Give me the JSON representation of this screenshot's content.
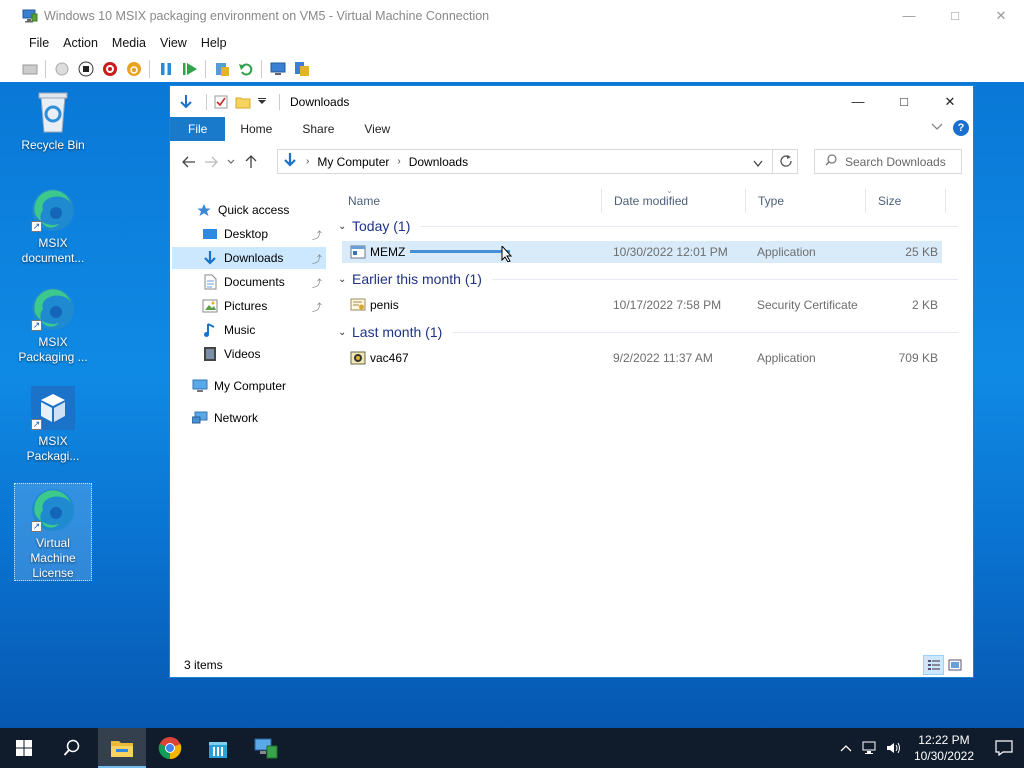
{
  "vm_window": {
    "title": "Windows 10 MSIX packaging environment on VM5 - Virtual Machine Connection",
    "menu": [
      "File",
      "Action",
      "Media",
      "View",
      "Help"
    ]
  },
  "desktop": {
    "icons": [
      {
        "label": "Recycle Bin",
        "icon": "recycle-bin-icon"
      },
      {
        "label": "MSIX document...",
        "icon": "edge-icon"
      },
      {
        "label": "MSIX Packaging ...",
        "icon": "edge-icon"
      },
      {
        "label": "MSIX Packagi...",
        "icon": "msix-packaging-tool-icon"
      },
      {
        "label": "Virtual Machine License",
        "icon": "edge-icon"
      }
    ]
  },
  "explorer": {
    "title": "Downloads",
    "ribbon_tabs": [
      "File",
      "Home",
      "Share",
      "View"
    ],
    "breadcrumb": [
      "My Computer",
      "Downloads"
    ],
    "search_placeholder": "Search Downloads",
    "nav": {
      "quick_access": "Quick access",
      "items": [
        "Desktop",
        "Downloads",
        "Documents",
        "Pictures",
        "Music",
        "Videos"
      ],
      "selected": "Downloads",
      "my_computer": "My Computer",
      "network": "Network"
    },
    "columns": [
      "Name",
      "Date modified",
      "Type",
      "Size"
    ],
    "groups": [
      {
        "label": "Today (1)",
        "files": [
          {
            "name": "MEMZ",
            "date": "10/30/2022 12:01 PM",
            "type": "Application",
            "size": "25 KB",
            "selected": true
          }
        ]
      },
      {
        "label": "Earlier this month (1)",
        "files": [
          {
            "name": "penis",
            "date": "10/17/2022 7:58 PM",
            "type": "Security Certificate",
            "size": "2 KB"
          }
        ]
      },
      {
        "label": "Last month (1)",
        "files": [
          {
            "name": "vac467",
            "date": "9/2/2022 11:37 AM",
            "type": "Application",
            "size": "709 KB"
          }
        ]
      }
    ],
    "status": "3 items"
  },
  "taskbar": {
    "time": "12:22 PM",
    "date": "10/30/2022"
  }
}
